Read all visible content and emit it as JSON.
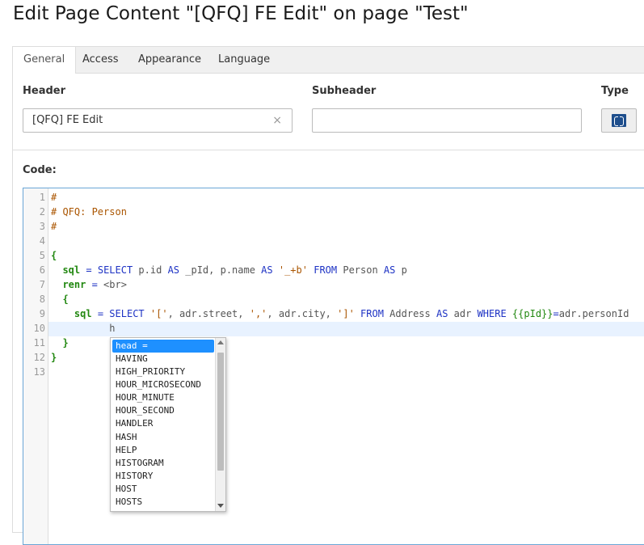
{
  "page_title": "Edit Page Content \"[QFQ] FE Edit\" on page \"Test\"",
  "tabs": [
    {
      "label": "General",
      "active": true
    },
    {
      "label": "Access",
      "active": false
    },
    {
      "label": "Appearance",
      "active": false
    },
    {
      "label": "Language",
      "active": false
    }
  ],
  "fields": {
    "header_label": "Header",
    "header_value": "[QFQ] FE Edit",
    "header_clear": "×",
    "subheader_label": "Subheader",
    "subheader_value": "",
    "type_label": "Type",
    "type_icon": "qfq-content-type-icon"
  },
  "code_label": "Code:",
  "editor": {
    "line_numbers": [
      "1",
      "2",
      "3",
      "4",
      "5",
      "6",
      "7",
      "8",
      "9",
      "10",
      "11",
      "12",
      "13"
    ],
    "active_line": 10,
    "lines": [
      "#",
      "# QFQ: Person",
      "#",
      "",
      "{",
      "  sql = SELECT p.id AS _pId, p.name AS '_+b' FROM Person AS p",
      "  renr = <br>",
      "  {",
      "    sql = SELECT '[', adr.street, ',', adr.city, ']' FROM Address AS adr WHERE {{pId}}=adr.personId",
      "          h",
      "  }",
      "}",
      ""
    ]
  },
  "autocomplete": {
    "selected": "head =",
    "items": [
      "head =",
      "HAVING",
      "HIGH_PRIORITY",
      "HOUR_MICROSECOND",
      "HOUR_MINUTE",
      "HOUR_SECOND",
      "HANDLER",
      "HASH",
      "HELP",
      "HISTOGRAM",
      "HISTORY",
      "HOST",
      "HOSTS"
    ]
  },
  "colors": {
    "keyword": "#1d32c4",
    "string": "#aa5500",
    "bracket": "#228811",
    "selection": "#1e90ff",
    "editor_border": "#6aa6d6"
  }
}
